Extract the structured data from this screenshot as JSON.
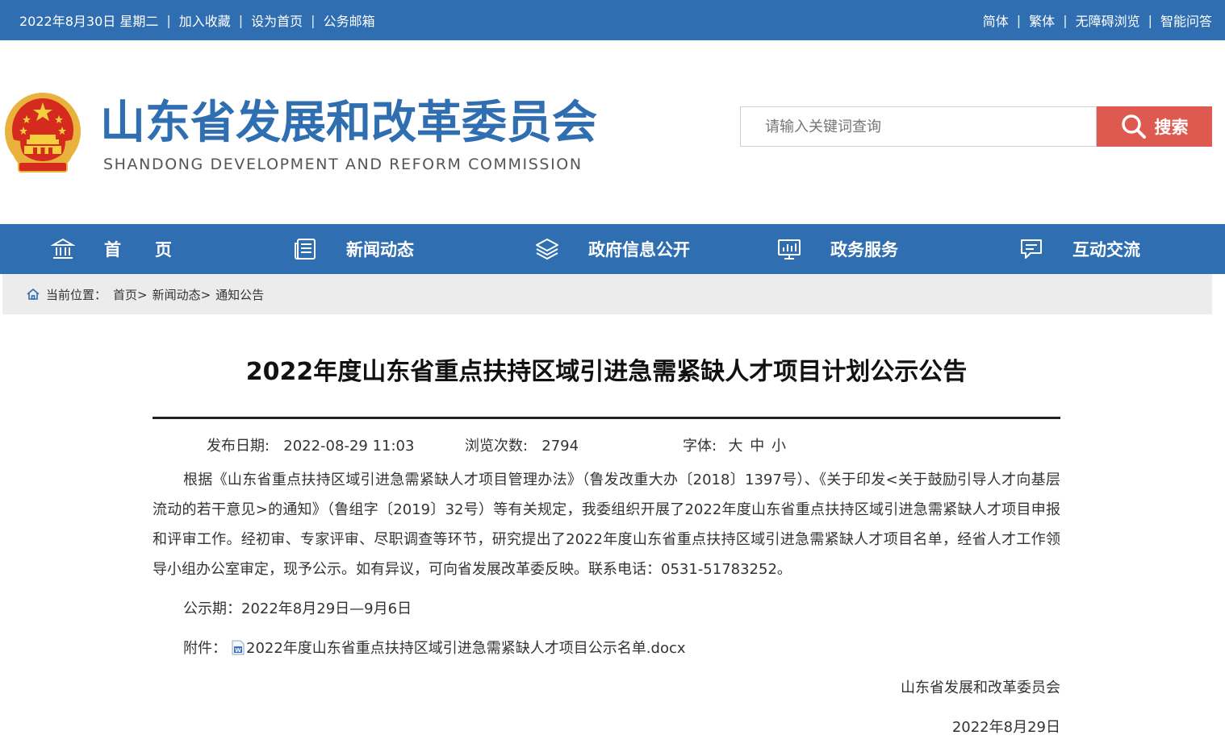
{
  "topbar": {
    "date": "2022年8月30日 星期二",
    "left_links": [
      "加入收藏",
      "设为首页",
      "公务邮箱"
    ],
    "right_links": [
      "简体",
      "繁体",
      "无障碍浏览",
      "智能问答"
    ]
  },
  "header": {
    "title_cn": "山东省发展和改革委员会",
    "title_en": "SHANDONG DEVELOPMENT AND REFORM COMMISSION",
    "search_placeholder": "请输入关键词查询",
    "search_button": "搜索"
  },
  "nav": {
    "items": [
      {
        "label": "首　　页",
        "icon": "building-icon"
      },
      {
        "label": "新闻动态",
        "icon": "news-list-icon"
      },
      {
        "label": "政府信息公开",
        "icon": "layers-icon"
      },
      {
        "label": "政务服务",
        "icon": "monitor-chart-icon"
      },
      {
        "label": "互动交流",
        "icon": "chat-icon"
      }
    ]
  },
  "breadcrumb": {
    "prefix": "当前位置：",
    "items": [
      "首页>",
      "新闻动态>",
      "通知公告"
    ]
  },
  "article": {
    "title": "2022年度山东省重点扶持区域引进急需紧缺人才项目计划公示公告",
    "publish_label": "发布日期:",
    "publish_date": "2022-08-29 11:03",
    "views_label": "浏览次数:",
    "views": "2794",
    "font_label": "字体:",
    "font_sizes": [
      "大",
      "中",
      "小"
    ],
    "body": "根据《山东省重点扶持区域引进急需紧缺人才项目管理办法》（鲁发改重大办〔2018〕1397号）、《关于印发<关于鼓励引导人才向基层流动的若干意见>的通知》（鲁组字〔2019〕32号）等有关规定，我委组织开展了2022年度山东省重点扶持区域引进急需紧缺人才项目申报和评审工作。经初审、专家评审、尽职调查等环节，研究提出了2022年度山东省重点扶持区域引进急需紧缺人才项目名单，经省人才工作领导小组办公室审定，现予公示。如有异议，可向省发展改革委反映。联系电话：0531-51783252。",
    "period": "公示期：2022年8月29日—9月6日",
    "attachment_label": "附件：",
    "attachment_name": "2022年度山东省重点扶持区域引进急需紧缺人才项目公示名单.docx",
    "signature": "山东省发展和改革委员会",
    "sign_date": "2022年8月29日"
  }
}
